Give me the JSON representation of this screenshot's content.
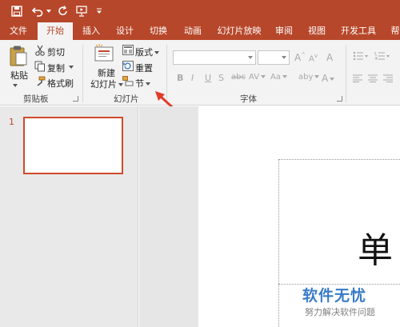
{
  "colors": {
    "accent": "#b7472a",
    "ribbon_bg": "#f3f3f3",
    "thumb_border": "#d04a2b",
    "arrow": "#e23b2b",
    "watermark_blue": "#3a7cc6"
  },
  "quick_access": {
    "save_icon": "save-icon",
    "undo_icon": "undo-icon",
    "redo_icon": "redo-icon",
    "present_icon": "present-from-start-icon",
    "customize_icon": "customize-toolbar-icon"
  },
  "tabs": [
    {
      "label": "文件"
    },
    {
      "label": "开始",
      "active": true
    },
    {
      "label": "插入"
    },
    {
      "label": "设计"
    },
    {
      "label": "切换"
    },
    {
      "label": "动画"
    },
    {
      "label": "幻灯片放映"
    },
    {
      "label": "审阅"
    },
    {
      "label": "视图"
    },
    {
      "label": "开发工具"
    },
    {
      "label": "帮"
    }
  ],
  "ribbon": {
    "clipboard": {
      "paste": "粘贴",
      "cut": "剪切",
      "copy": "复制",
      "format_painter": "格式刷",
      "group_label": "剪贴板"
    },
    "slides": {
      "new_slide": "新建\n幻灯片",
      "new_slide_line1": "新建",
      "new_slide_line2": "幻灯片",
      "layout": "版式",
      "reset": "重置",
      "section": "节",
      "group_label": "幻灯片"
    },
    "font": {
      "group_label": "字体",
      "font_name_value": "",
      "font_size_value": "",
      "grow": "A",
      "shrink": "A",
      "clear": "A",
      "bold": "B",
      "italic": "I",
      "underline": "U",
      "shadow": "S",
      "strike": "abc",
      "spacing": "AV",
      "case": "Aa",
      "highlight": "aby",
      "color": "A"
    }
  },
  "slides_pane": {
    "slide_number": "1"
  },
  "slide": {
    "title_char": "单"
  },
  "watermark": {
    "logo": "软件无忧",
    "sub": "努力解决软件问题"
  }
}
